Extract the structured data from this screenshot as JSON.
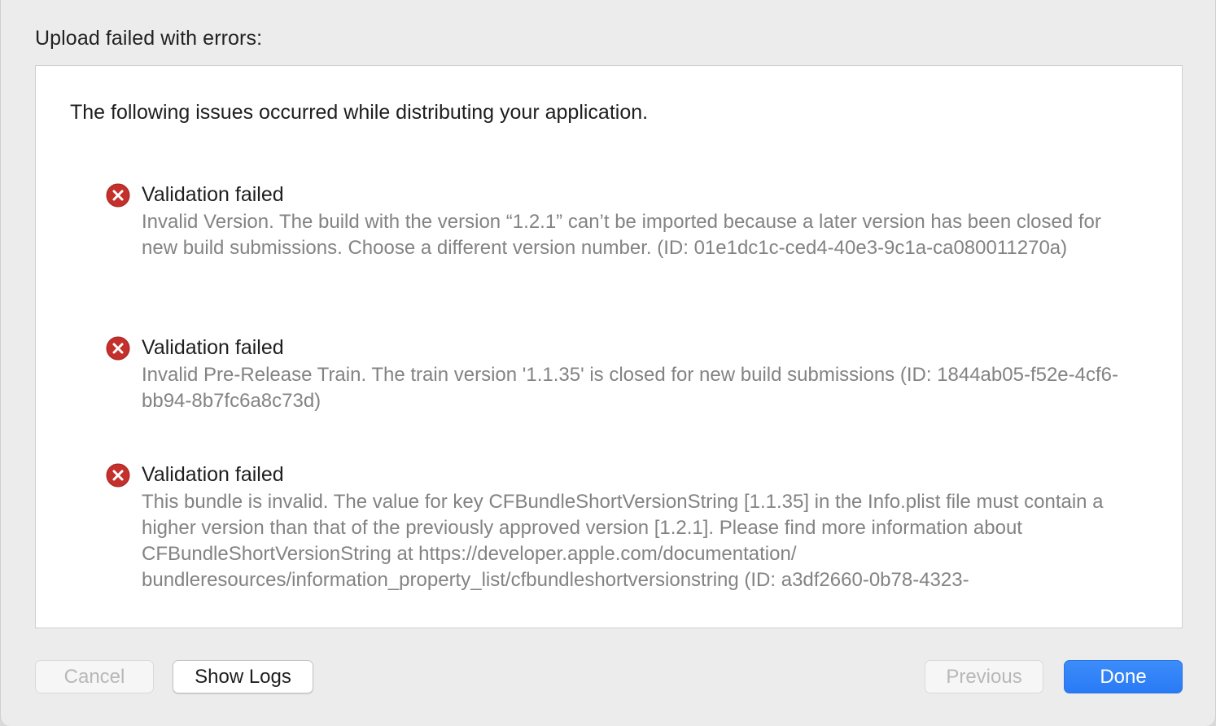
{
  "dialog": {
    "title": "Upload failed with errors:",
    "intro": "The following issues occurred while distributing your application."
  },
  "issues": [
    {
      "icon": "error-icon",
      "title": "Validation failed",
      "detail": "Invalid Version. The build with the version “1.2.1” can’t be imported because a later version has been closed for new build submissions. Choose a different version number. (ID: 01e1dc1c-ced4-40e3-9c1a-ca080011270a)"
    },
    {
      "icon": "error-icon",
      "title": "Validation failed",
      "detail": "Invalid Pre-Release Train. The train version '1.1.35' is closed for new build submissions (ID: 1844ab05-f52e-4cf6-bb94-8b7fc6a8c73d)"
    },
    {
      "icon": "error-icon",
      "title": "Validation failed",
      "detail": "This bundle is invalid. The value for key CFBundleShortVersionString [1.1.35] in the Info.plist file must contain a higher version than that of the previously approved version [1.2.1]. Please find more information about CFBundleShortVersionString at https://developer.apple.com/documentation/ bundleresources/information_property_list/cfbundleshortversionstring (ID: a3df2660-0b78-4323-"
    }
  ],
  "buttons": {
    "cancel": "Cancel",
    "show_logs": "Show Logs",
    "previous": "Previous",
    "done": "Done"
  },
  "colors": {
    "error_red": "#c4302b",
    "accent_blue": "#2f80f7"
  }
}
